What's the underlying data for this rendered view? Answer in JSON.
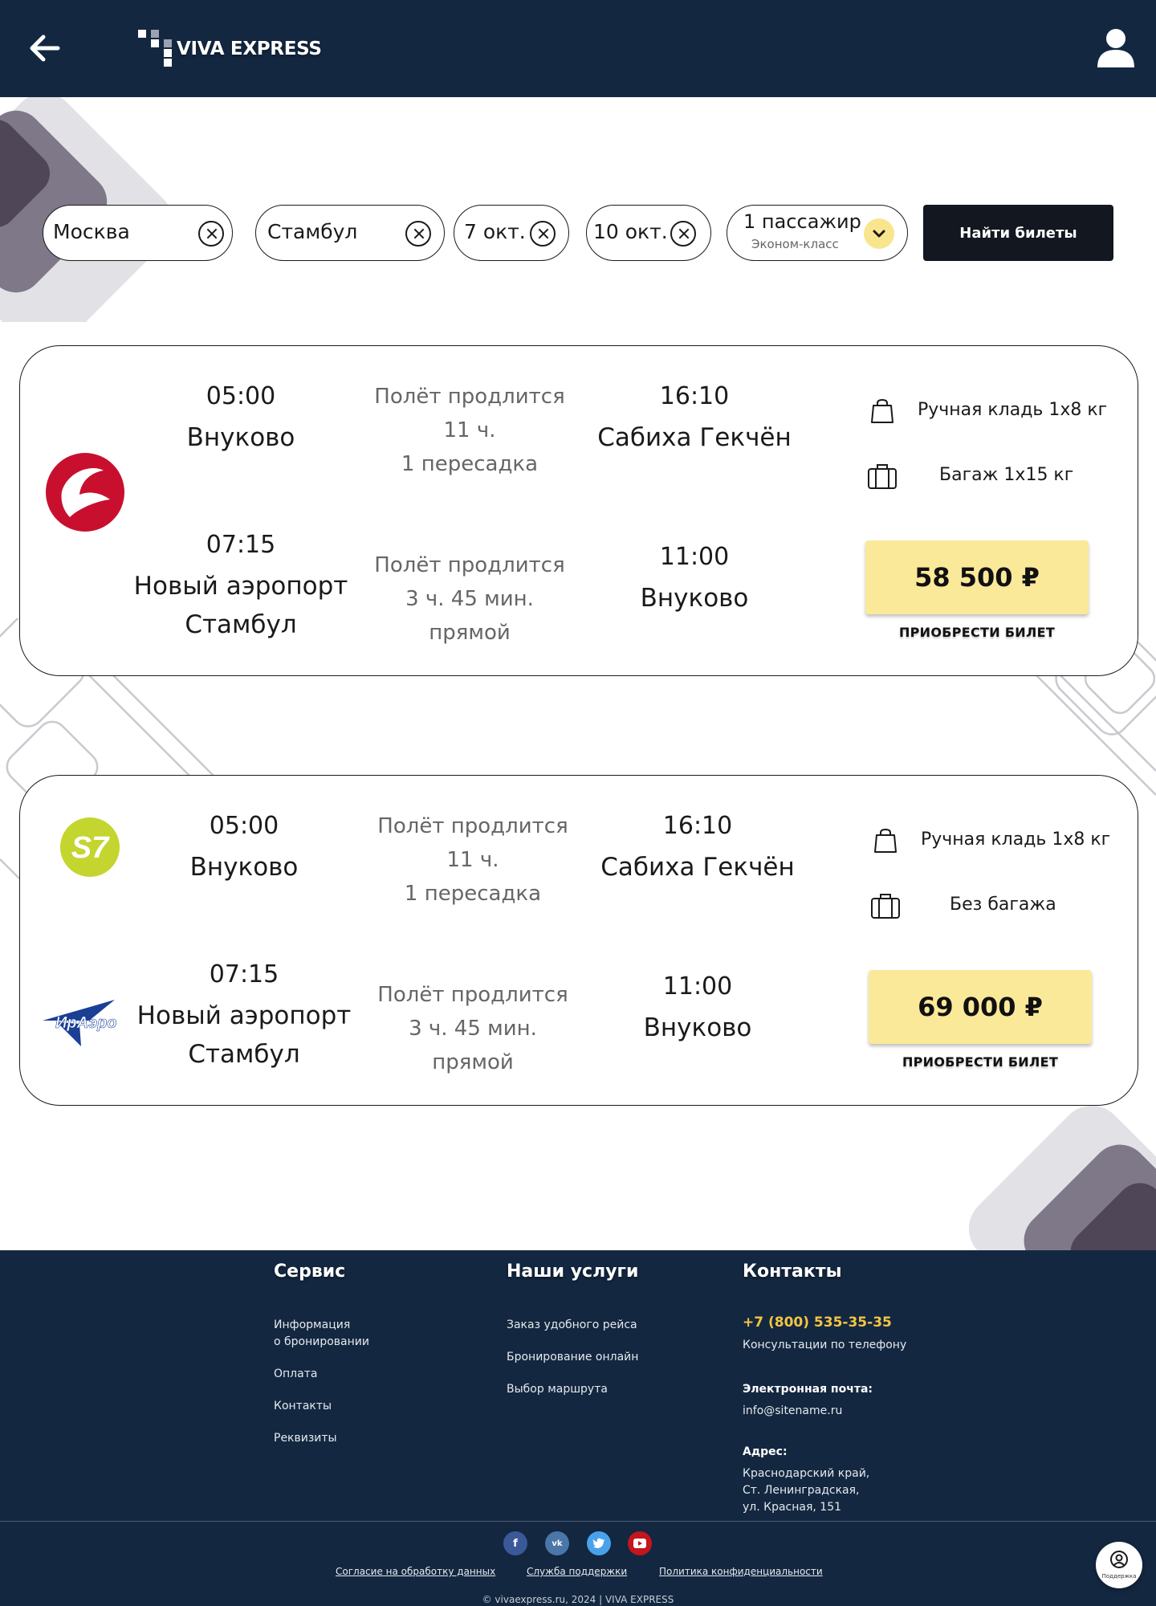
{
  "header": {
    "logo_text": "VIVA EXPRESS",
    "back_icon": "arrow-left-icon",
    "user_icon": "user-icon"
  },
  "search": {
    "from": "Москва",
    "to": "Стамбул",
    "date_there": "7 окт.",
    "date_back": "10 окт.",
    "passengers": "1 пассажир",
    "class": "Эконом-класс",
    "find_button": "Найти билеты"
  },
  "tickets": [
    {
      "airline_logo": "turkish-airlines-logo",
      "outbound": {
        "depart_time": "05:00",
        "depart_airport": "Внуково",
        "duration_label": "Полёт продлится",
        "duration": "11 ч.",
        "stops": "1 пересадка",
        "arrive_time": "16:10",
        "arrive_airport": "Сабиха Гекчён"
      },
      "return": {
        "depart_time": "07:15",
        "depart_airport_line1": "Новый аэропорт",
        "depart_airport_line2": "Стамбул",
        "duration_label": "Полёт продлится",
        "duration": "3 ч. 45 мин.",
        "stops": "прямой",
        "arrive_time": "11:00",
        "arrive_airport": "Внуково"
      },
      "hand_luggage": "Ручная кладь 1х8 кг",
      "baggage": "Багаж 1х15 кг",
      "price": "58 500 ₽",
      "buy_label": "ПРИОБРЕСТИ БИЛЕТ"
    },
    {
      "airline_logo": "s7-logo",
      "return_airline_logo": "iraero-logo",
      "return_airline_text": "ИрАэро",
      "s7_text": "S7",
      "outbound": {
        "depart_time": "05:00",
        "depart_airport": "Внуково",
        "duration_label": "Полёт продлится",
        "duration": "11 ч.",
        "stops": "1 пересадка",
        "arrive_time": "16:10",
        "arrive_airport": "Сабиха Гекчён"
      },
      "return": {
        "depart_time": "07:15",
        "depart_airport_line1": "Новый аэропорт",
        "depart_airport_line2": "Стамбул",
        "duration_label": "Полёт продлится",
        "duration": "3 ч. 45 мин.",
        "stops": "прямой",
        "arrive_time": "11:00",
        "arrive_airport": "Внуково"
      },
      "hand_luggage": "Ручная кладь 1х8 кг",
      "baggage": "Без багажа",
      "price": "69 000 ₽",
      "buy_label": "ПРИОБРЕСТИ БИЛЕТ"
    }
  ],
  "footer": {
    "service": {
      "title": "Сервис",
      "link1_line1": "Информация",
      "link1_line2": "о бронировании",
      "link2": "Оплата",
      "link3": "Контакты",
      "link4": "Реквизиты"
    },
    "services": {
      "title": "Наши услуги",
      "link1": "Заказ удобного рейса",
      "link2": "Бронирование онлайн",
      "link3": "Выбор маршрута"
    },
    "contacts": {
      "title": "Контакты",
      "phone": "+7 (800) 535-35-35",
      "phone_note": "Консультации по телефону",
      "email_label": "Электронная почта:",
      "email": "info@sitename.ru",
      "address_label": "Адрес:",
      "address_line1": "Краснодарский край,",
      "address_line2": "Ст. Ленинградская,",
      "address_line3": "ул. Красная, 151"
    },
    "social": {
      "facebook": "f",
      "vk": "vk",
      "twitter_icon": "twitter-icon",
      "youtube_icon": "youtube-icon"
    },
    "legal": {
      "consent": "Согласие на обработку данных",
      "support": "Служба поддержки",
      "privacy": "Политика конфиденциальности"
    },
    "copyright": "© vivaexpress.ru, 2024 | VIVA EXPRESS",
    "support_button_label": "Поддержка"
  },
  "colors": {
    "navy": "#132740",
    "price_yellow": "#fbe99a",
    "phone_yellow": "#f4c542",
    "button_dark": "#131720"
  }
}
